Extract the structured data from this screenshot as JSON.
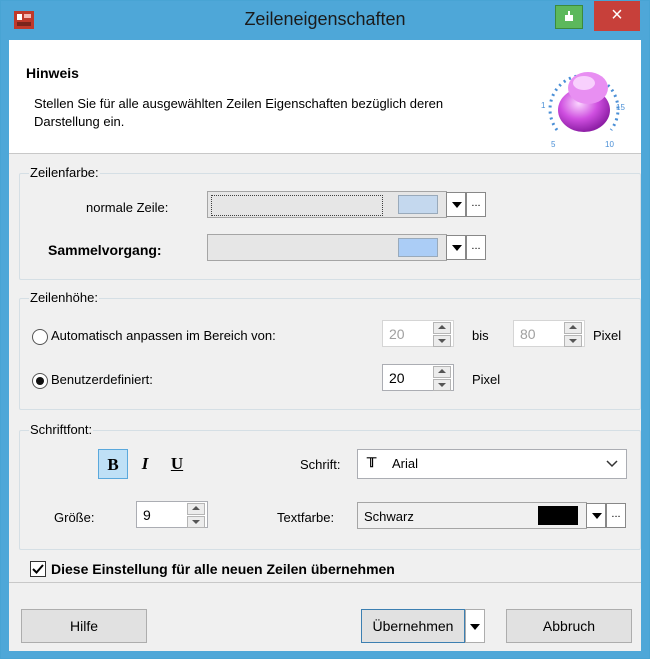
{
  "window": {
    "title": "Zeileneigenschaften",
    "close_label": "×"
  },
  "hint": {
    "title": "Hinweis",
    "text": "Stellen Sie für alle ausgewählten Zeilen Eigenschaften bezüglich deren Darstellung ein.",
    "dial_labels": [
      "1",
      "5",
      "10",
      "15"
    ]
  },
  "zeilenfarbe": {
    "legend": "Zeilenfarbe:",
    "normal_label": "normale Zeile:",
    "normal_color": "#c4d8ee",
    "sammel_label": "Sammelvorgang:",
    "sammel_color": "#abcdf6",
    "ellipsis": "..."
  },
  "zeilenhoehe": {
    "legend": "Zeilenhöhe:",
    "auto_label": "Automatisch anpassen im Bereich von:",
    "auto_selected": false,
    "auto_min": "20",
    "bis_label": "bis",
    "auto_max": "80",
    "pixel_label": "Pixel",
    "custom_label": "Benutzerdefiniert:",
    "custom_selected": true,
    "custom_value": "20",
    "custom_pixel_label": "Pixel"
  },
  "schriftfont": {
    "legend": "Schriftfont:",
    "bold": "B",
    "bold_active": true,
    "italic": "I",
    "underline": "U",
    "schrift_label": "Schrift:",
    "font_icon": "𝕋",
    "font_value": "Arial",
    "groesse_label": "Größe:",
    "groesse_value": "9",
    "textfarbe_label": "Textfarbe:",
    "textfarbe_value": "Schwarz",
    "textfarbe_color": "#000000"
  },
  "apply_all": {
    "label": "Diese Einstellung für alle neuen Zeilen übernehmen",
    "checked": true
  },
  "buttons": {
    "hilfe": "Hilfe",
    "uebernehmen": "Übernehmen",
    "abbruch": "Abbruch"
  },
  "colors": {
    "titlebar": "#4ea7d8",
    "close": "#c7403a",
    "accent": "#5aa8dc"
  }
}
